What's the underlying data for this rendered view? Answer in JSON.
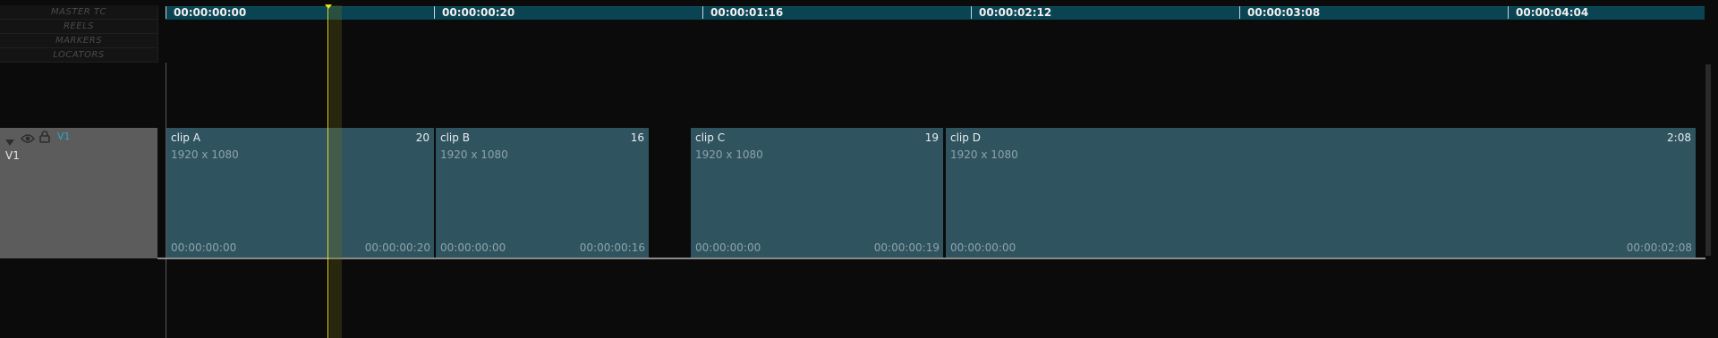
{
  "header_rows": [
    "MASTER TC",
    "REELS",
    "MARKERS",
    "LOCATORS"
  ],
  "ruler_ticks": [
    "00:00:00:00",
    "00:00:00:20",
    "00:00:01:16",
    "00:00:02:12",
    "00:00:03:08",
    "00:00:04:04"
  ],
  "track": {
    "name_small": "V1",
    "name": "V1",
    "accent": "#2ea7c7"
  },
  "clips": [
    {
      "name": "clip A",
      "frames": "20",
      "res": "1920 x 1080",
      "tc_in": "00:00:00:00",
      "tc_out": "00:00:00:20"
    },
    {
      "name": "clip B",
      "frames": "16",
      "res": "1920 x 1080",
      "tc_in": "00:00:00:00",
      "tc_out": "00:00:00:16"
    },
    {
      "name": "clip C",
      "frames": "19",
      "res": "1920 x 1080",
      "tc_in": "00:00:00:00",
      "tc_out": "00:00:00:19"
    },
    {
      "name": "clip D",
      "frames": "2:08",
      "res": "1920 x 1080",
      "tc_in": "00:00:00:00",
      "tc_out": "00:00:02:08"
    }
  ],
  "colors": {
    "ruler_bg": "#0a4453",
    "clip_bg": "#2f545f",
    "playhead": "#e8e21a",
    "track_header_bg": "#5c5c5c"
  },
  "icons": [
    "triangle-down-icon",
    "eye-icon",
    "lock-icon"
  ]
}
